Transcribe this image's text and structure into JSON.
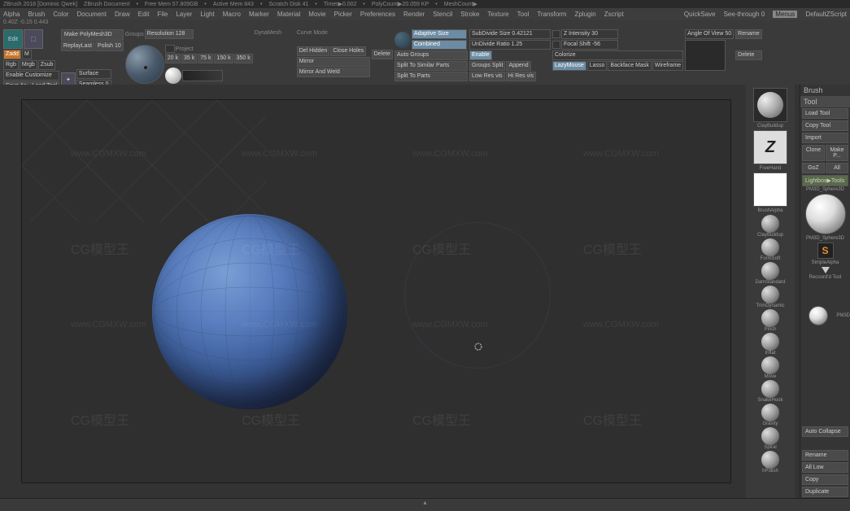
{
  "titlebar": {
    "app": "ZBrush 2018 [Dominic Qwek]",
    "doc": "ZBrush Document",
    "mem": "Free Mem 57.809GB",
    "activemem": "Active Mem 843",
    "scratch": "Scratch Disk 41",
    "timer": "Timer▶0.002",
    "poly": "PolyCount▶20.059 KP",
    "mesh": "MeshCount▶"
  },
  "menubar": {
    "items": [
      "Alpha",
      "Brush",
      "Color",
      "Document",
      "Draw",
      "Edit",
      "File",
      "Layer",
      "Light",
      "Macro",
      "Marker",
      "Material",
      "Movie",
      "Picker",
      "Preferences",
      "Render",
      "Stencil",
      "Stroke",
      "Texture",
      "Tool",
      "Transform",
      "Zplugin",
      "Zscript"
    ],
    "quicksave": "QuickSave",
    "seethrough": "See-through 0",
    "menus": "Menus",
    "script": "DefaultZScript"
  },
  "coords": "0.40Z -0.15 0.443",
  "left_controls": {
    "edit": "Edit",
    "zadd": "Zadd",
    "rgb": "Rgb",
    "m": "M",
    "mrgb": "Mrgb",
    "zsub": "Zsub",
    "enable_customize": "Enable Customize",
    "save_as": "Save As",
    "load_tool": "Load Tool",
    "make_polymesh": "Make PolyMesh3D",
    "replay_last": "ReplayLast",
    "polish": "Polish 10",
    "surface": "Surface",
    "seamless": "Seamless 0"
  },
  "geometry": {
    "groups": "Groups",
    "resolution": "Resolution 128",
    "project": "Project",
    "subdivs": [
      "20 k",
      "35 k",
      "75 k",
      "150 k",
      "350 k"
    ]
  },
  "dynamesh": {
    "label": "DynaMesh"
  },
  "curve": {
    "label": "Curve Mode"
  },
  "modify": {
    "del_hidden": "Del Hidden",
    "close_holes": "Close Holes",
    "delete": "Delete",
    "mirror": "Mirror",
    "mirror_weld": "Mirror And Weld"
  },
  "polygroup": {
    "adaptive": "Adaptive Size",
    "combined": "Combined",
    "auto_groups": "Auto Groups",
    "split_similar": "Split To Similar Parts",
    "split_parts": "Split To Parts"
  },
  "subdivide": {
    "size": "SubDivide Size 0.42121",
    "ratio": "UnDivide Ratio 1.25",
    "enable": "Enable",
    "groups_split": "Groups Split",
    "low_res": "Low Res vis",
    "append": "Append",
    "hi_res": "Hi Res vis"
  },
  "brush_settings": {
    "zintensity": "Z Intensity 30",
    "focal": "Focal Shift -56",
    "colorize": "Colorize",
    "lazymouse": "LazyMouse",
    "lasso": "Lasso",
    "backface": "Backface Mask",
    "wireframe": "Wireframe",
    "rename": "Rename",
    "delete": "Delete"
  },
  "angle": {
    "label": "Angle Of View 50"
  },
  "right_brushes": {
    "current": "ClayBuildup",
    "stroke": "FreeHand",
    "alpha": "BrushAlpha",
    "list": [
      "ClayBuildup",
      "FormSoft",
      "DamStandard",
      "TrimDynamic",
      "Pinch",
      "Inflat",
      "Move",
      "SnakeHook",
      "Gravity",
      "Spiral",
      "hPolish"
    ]
  },
  "sidebar": {
    "brush": "Brush",
    "tool": "Tool",
    "load": "Load Tool",
    "copy": "Copy Tool",
    "import": "Import",
    "clone": "Clone",
    "makep": "Make P...",
    "goz": "GoZ",
    "all": "All",
    "lightbox": "Lightbox▶Tools",
    "toolname1": "PM3D_Sphere3D",
    "toolname2": "PM3D_Sphere3D",
    "simplealpha": "SimpleAlpha",
    "recoord": "Recoord'd  Tool",
    "pm3d": "PM3D",
    "autocollapse": "Auto Collapse",
    "rename": "Rename",
    "all_low": "All Low",
    "copy2": "Copy",
    "duplicate": "Duplicate"
  },
  "watermarks": [
    "www.CGMXW.com",
    "CG模型王"
  ]
}
